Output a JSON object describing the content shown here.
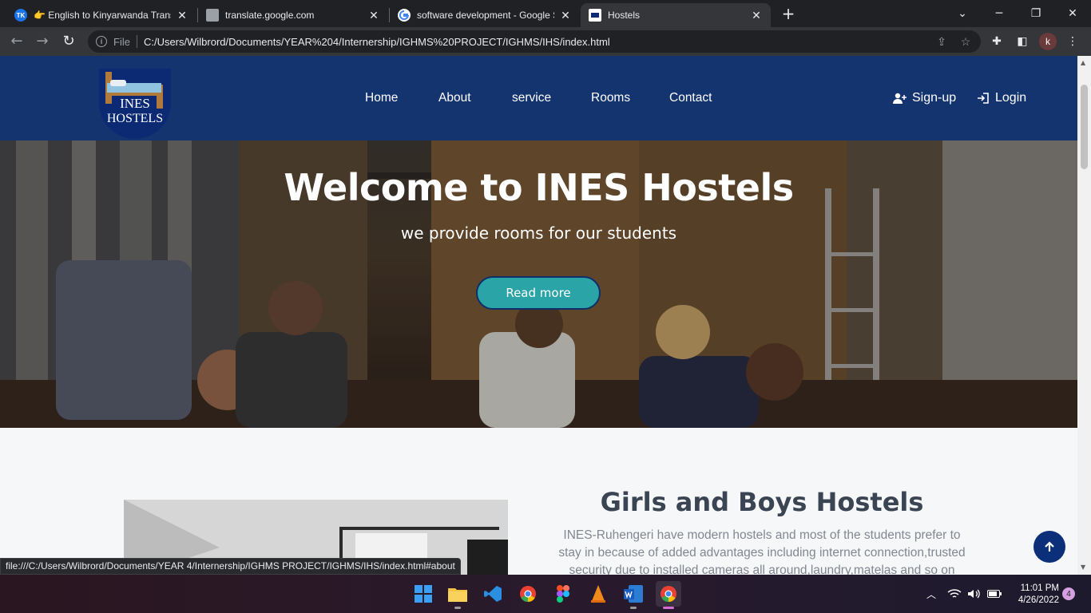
{
  "browser": {
    "tabs": [
      {
        "title": "👉 English to Kinyarwanda Trans",
        "favicon": "tk-favicon",
        "active": false
      },
      {
        "title": "translate.google.com",
        "favicon": "page-favicon",
        "active": false
      },
      {
        "title": "software development - Google S",
        "favicon": "google-favicon",
        "active": false
      },
      {
        "title": "Hostels",
        "favicon": "hostels-favicon",
        "active": true
      }
    ],
    "address": {
      "scheme_label": "File",
      "url": "C:/Users/Wilbrord/Documents/YEAR%204/Internership/IGHMS%20PROJECT/IGHMS/IHS/index.html"
    },
    "profile_initial": "k",
    "status_link": "file:///C:/Users/Wilbrord/Documents/YEAR 4/Internership/IGHMS PROJECT/IGHMS/IHS/index.html#about"
  },
  "site": {
    "logo": {
      "line1": "INES",
      "line2": "HOSTELS"
    },
    "nav": [
      "Home",
      "About",
      "service",
      "Rooms",
      "Contact"
    ],
    "auth": {
      "signup": "Sign-up",
      "login": "Login"
    },
    "hero": {
      "title": "Welcome to INES Hostels",
      "subtitle": "we provide rooms for our students",
      "button": "Read more"
    },
    "about": {
      "title": "Girls and Boys Hostels",
      "text": "INES-Ruhengeri have modern hostels and most of the students prefer to stay in because of added advantages including internet connection,trusted security due to installed cameras all around,laundry,matelas and so on"
    }
  },
  "taskbar": {
    "time": "11:01 PM",
    "date": "4/26/2022",
    "notifications": "4"
  },
  "colors": {
    "header_bg": "#143470",
    "button_teal": "#2aa4a6",
    "heading": "#3a4453",
    "body_text": "#808891",
    "to_top": "#0c2f7a"
  }
}
